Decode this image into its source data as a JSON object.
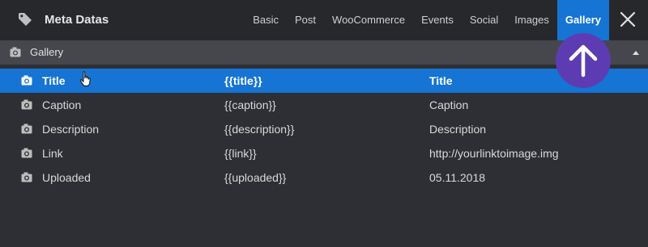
{
  "header": {
    "title": "Meta Datas",
    "icon": "tag-icon",
    "tabs": [
      {
        "label": "Basic"
      },
      {
        "label": "Post"
      },
      {
        "label": "WooCommerce"
      },
      {
        "label": "Events"
      },
      {
        "label": "Social"
      },
      {
        "label": "Images"
      },
      {
        "label": "Gallery",
        "active": true
      }
    ],
    "close_icon": "close-icon"
  },
  "section": {
    "label": "Gallery",
    "icon": "camera-icon",
    "collapse_icon": "caret-up-icon"
  },
  "rows": [
    {
      "name": "Title",
      "tag": "{{title}}",
      "example": "Title",
      "selected": true
    },
    {
      "name": "Caption",
      "tag": "{{caption}}",
      "example": "Caption"
    },
    {
      "name": "Description",
      "tag": "{{description}}",
      "example": "Description"
    },
    {
      "name": "Link",
      "tag": "{{link}}",
      "example": "http://yourlinktoimage.img"
    },
    {
      "name": "Uploaded",
      "tag": "{{uploaded}}",
      "example": "05.11.2018"
    }
  ],
  "badge": {
    "icon": "arrow-up-icon"
  },
  "colors": {
    "accent": "#1574d4",
    "badge": "#5d3cb3",
    "background": "#2e2f34",
    "topbar": "#27282c",
    "section_header": "#45474d"
  }
}
